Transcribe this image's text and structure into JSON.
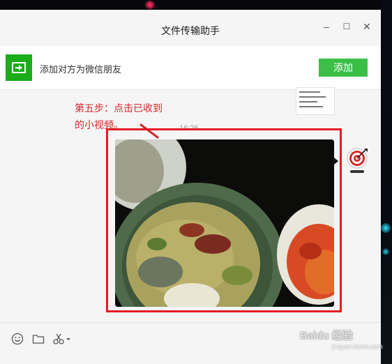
{
  "window": {
    "title": "文件传输助手",
    "minimize_glyph": "–",
    "maximize_glyph": "☐",
    "close_glyph": "✕"
  },
  "banner": {
    "text": "添加对方为微信朋友",
    "add_button_label": "添加",
    "icon": "arrow-right-icon"
  },
  "chat": {
    "annotation": "第五步：点击已收到\n的小视频。",
    "timestamp": "16:26",
    "video_message": {
      "icon": "video-thumbnail"
    },
    "avatar": {
      "icon": "target-avatar-icon"
    }
  },
  "toolbar": {
    "icons": [
      "emoji-icon",
      "folder-icon",
      "scissors-icon"
    ]
  },
  "watermark": {
    "text": "Baidu 经验",
    "sub": "jingyan.baidu.com"
  },
  "colors": {
    "accent_green": "#1aad19",
    "add_button": "#3cbf47",
    "annotation_red": "#d42626",
    "highlight_red": "#e41c24"
  }
}
